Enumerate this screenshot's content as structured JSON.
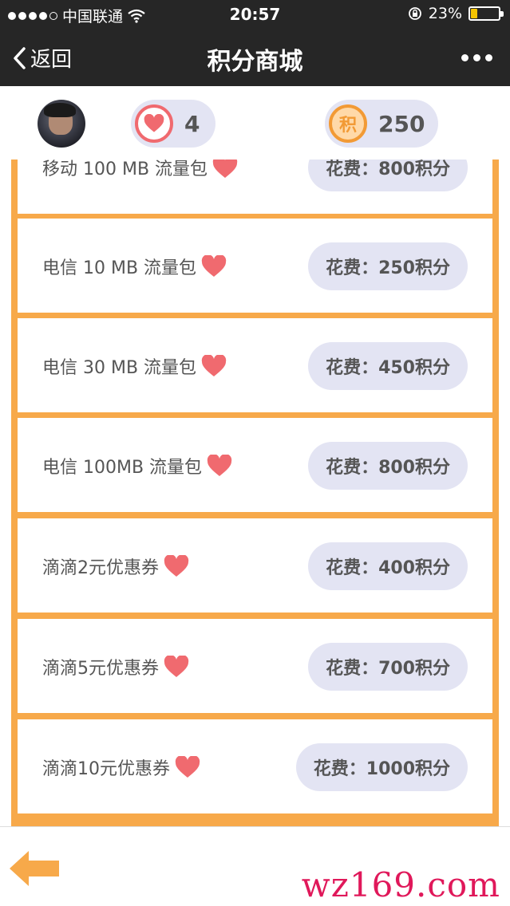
{
  "status_bar": {
    "carrier": "中国联通",
    "time": "20:57",
    "battery_text": "23%",
    "battery_level": 0.23
  },
  "nav": {
    "back_label": "返回",
    "title": "积分商城"
  },
  "profile": {
    "hearts": "4",
    "points": "250",
    "points_badge": "积"
  },
  "items": [
    {
      "label": "移动 100 MB 流量包",
      "price": "花费：800积分"
    },
    {
      "label": "电信 10 MB 流量包",
      "price": "花费：250积分"
    },
    {
      "label": "电信 30 MB 流量包",
      "price": "花费：450积分"
    },
    {
      "label": "电信 100MB 流量包",
      "price": "花费：800积分"
    },
    {
      "label": "滴滴2元优惠券",
      "price": "花费：400积分"
    },
    {
      "label": "滴滴5元优惠券",
      "price": "花费：700积分"
    },
    {
      "label": "滴滴10元优惠券",
      "price": "花费：1000积分"
    }
  ],
  "watermark": "wz169.com",
  "colors": {
    "accent_orange": "#f7a94a",
    "heart_red": "#f06a6f",
    "pill_bg": "#e3e4f3",
    "topbar": "#262626"
  }
}
